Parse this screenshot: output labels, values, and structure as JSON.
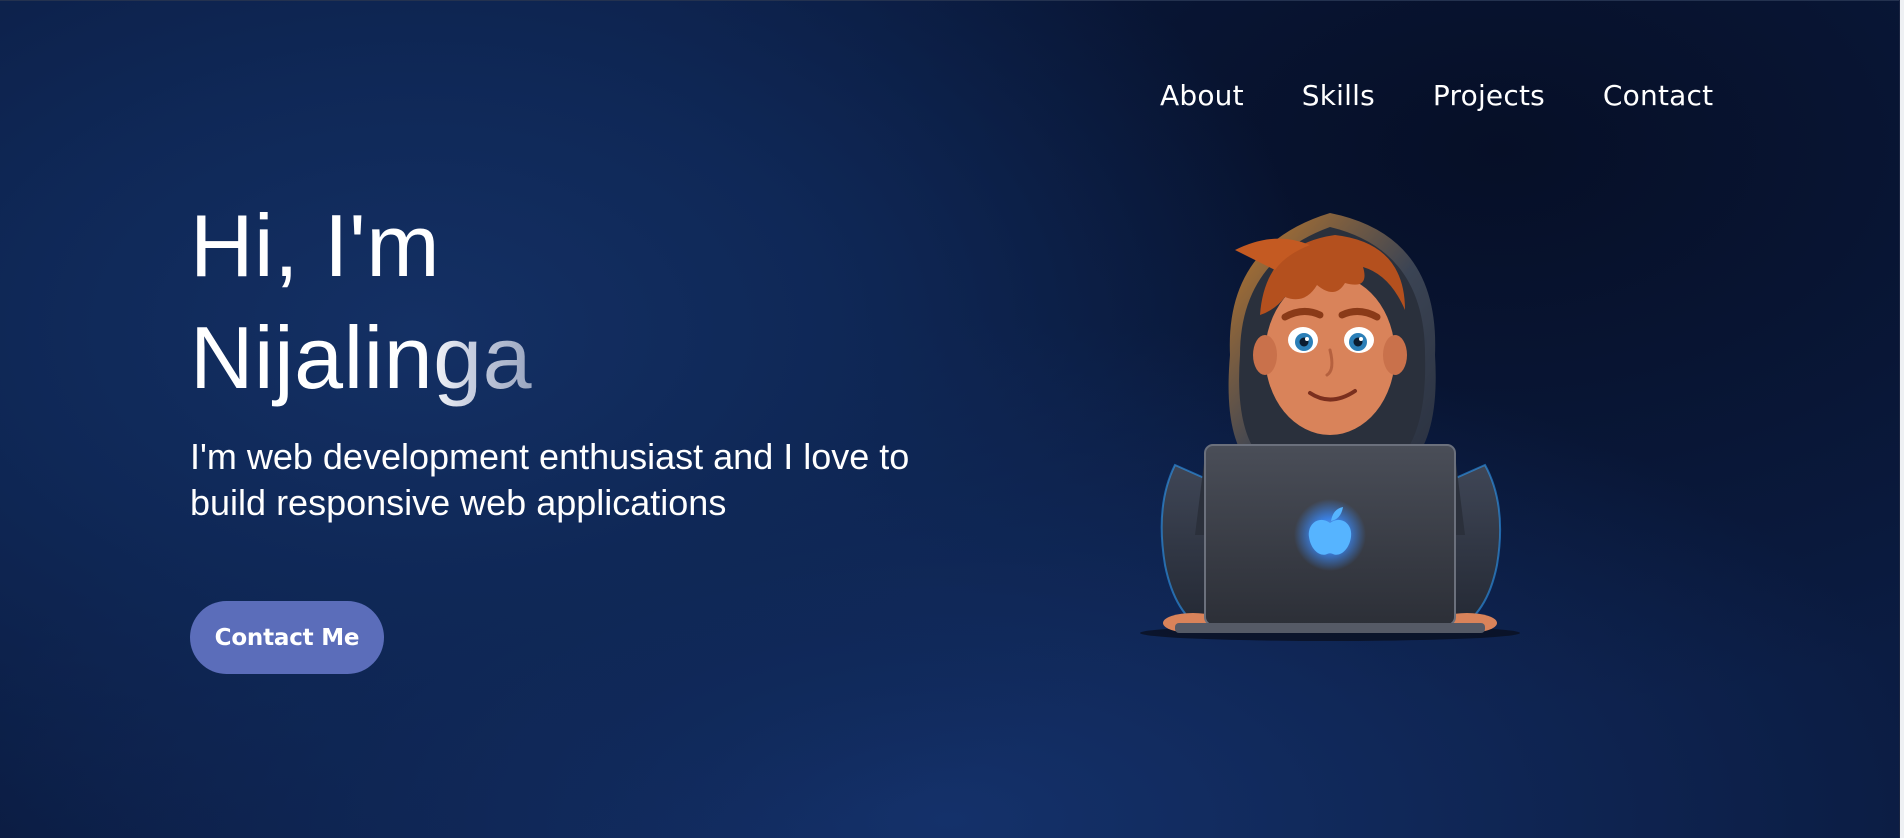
{
  "nav": {
    "items": [
      {
        "label": "About"
      },
      {
        "label": "Skills"
      },
      {
        "label": "Projects"
      },
      {
        "label": "Contact"
      }
    ]
  },
  "hero": {
    "greeting": "Hi, I'm",
    "name": "Nijalinga",
    "tagline": "I'm web development enthusiast and I love to build responsive web applications",
    "cta_label": "Contact Me"
  },
  "illustration": {
    "icon": "developer-avatar-with-laptop",
    "laptop_logo": "apple-logo-icon"
  },
  "colors": {
    "background": "#0b1c42",
    "background_glow": "#143064",
    "cta": "#5b6dba",
    "text": "#ffffff",
    "logo_glow": "#3a8cff"
  }
}
